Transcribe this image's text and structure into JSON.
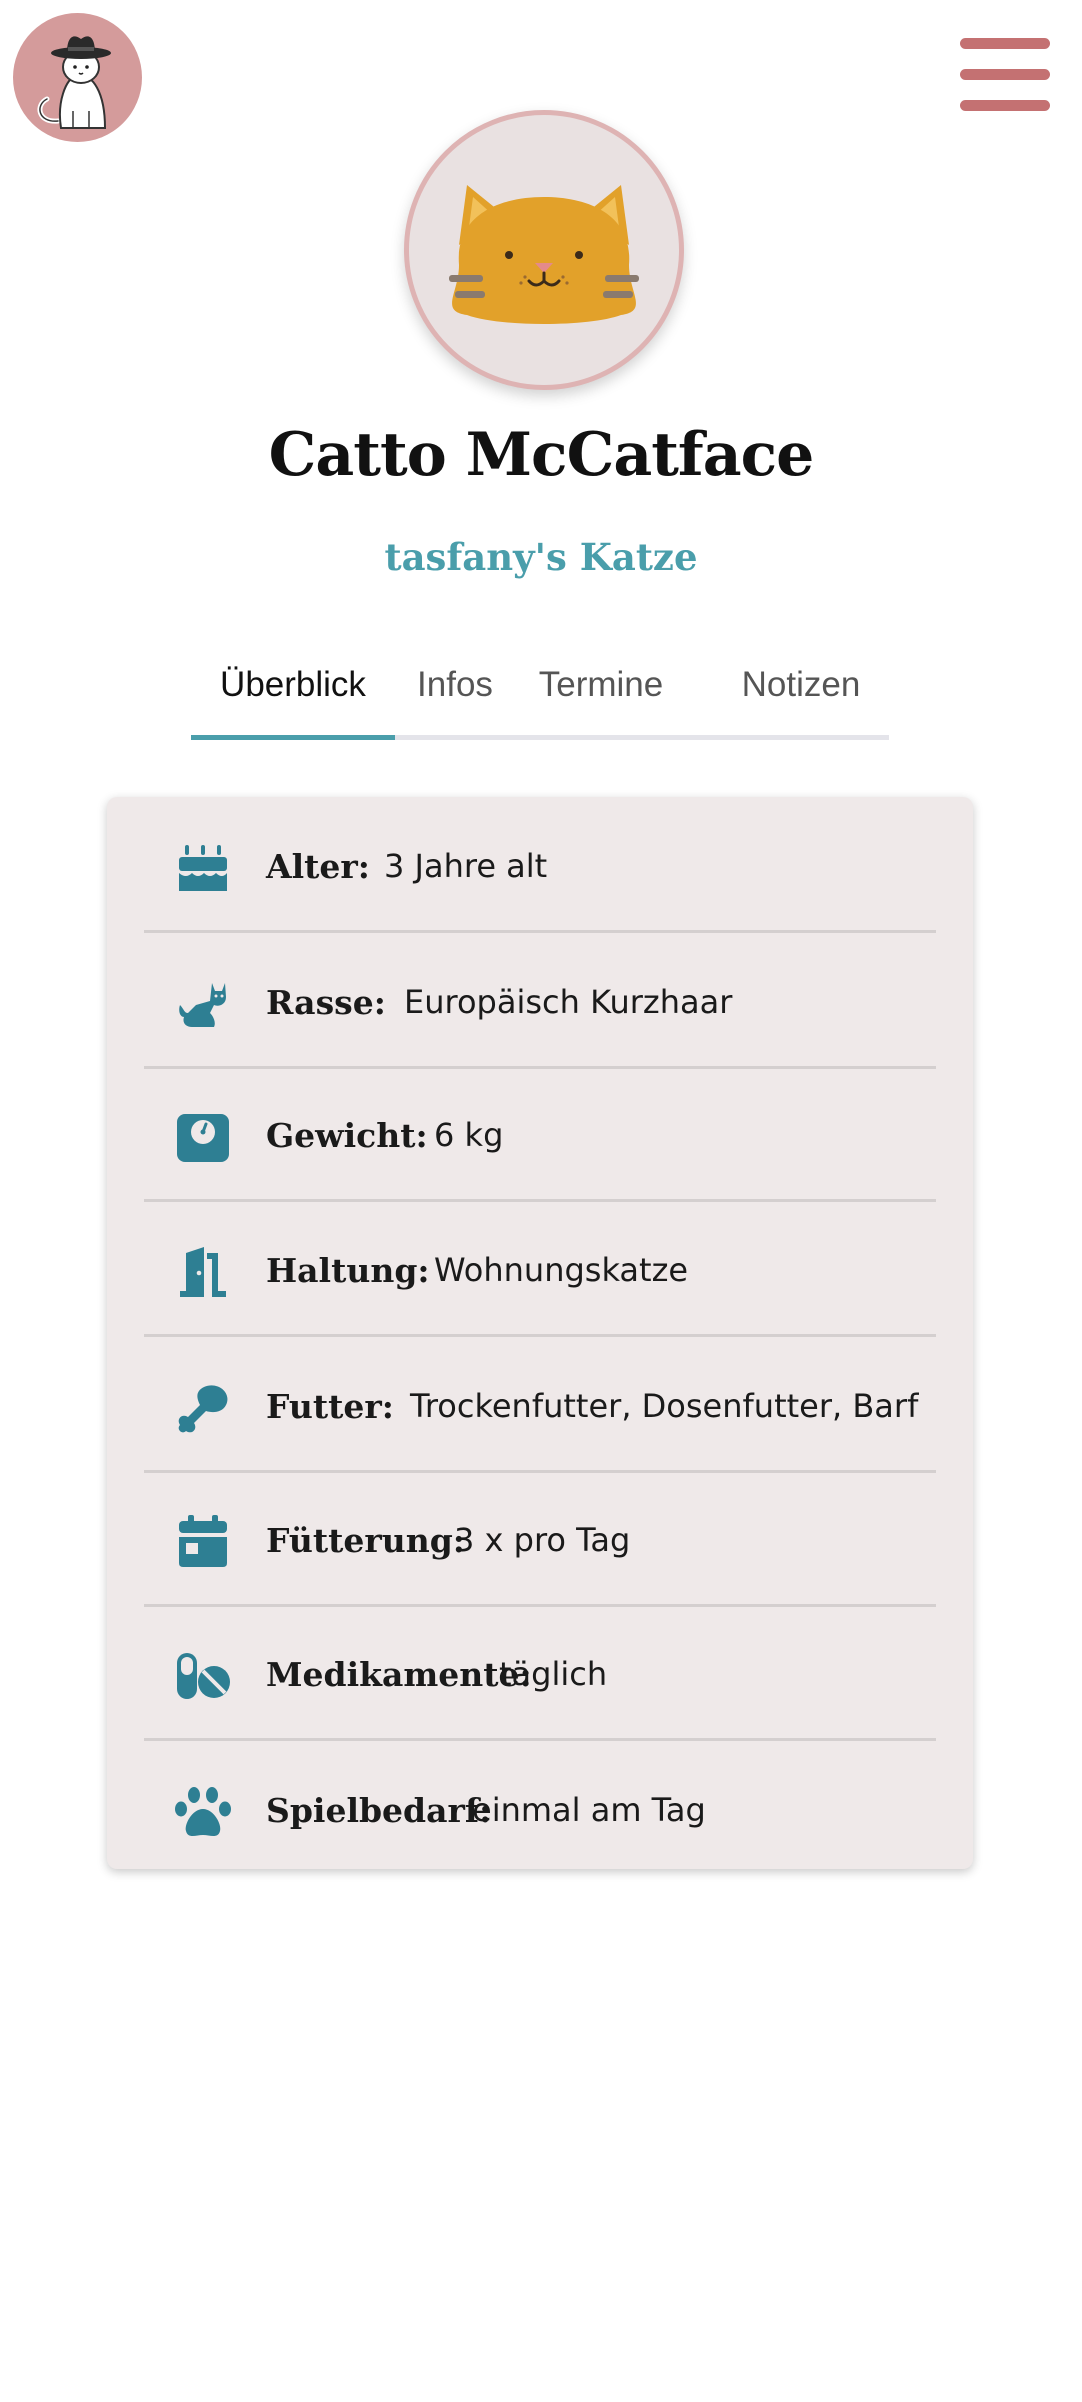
{
  "header": {
    "logo_icon": "cat-with-cowboy-hat-logo",
    "menu_icon": "hamburger-menu-icon"
  },
  "profile": {
    "avatar_icon": "orange-cat-face-avatar",
    "name": "Catto McCatface",
    "owner": "tasfany's Katze"
  },
  "tabs": [
    {
      "label": "Überblick",
      "active": true
    },
    {
      "label": "Infos",
      "active": false
    },
    {
      "label": "Termine",
      "active": false
    },
    {
      "label": "Notizen",
      "active": false
    }
  ],
  "overview": [
    {
      "icon": "birthday-cake-icon",
      "label": "Alter:",
      "value": "3 Jahre alt"
    },
    {
      "icon": "cat-icon",
      "label": "Rasse:",
      "value": "Europäisch Kurzhaar"
    },
    {
      "icon": "weight-scale-icon",
      "label": "Gewicht:",
      "value": "6 kg"
    },
    {
      "icon": "door-open-icon",
      "label": "Haltung:",
      "value": "Wohnungskatze"
    },
    {
      "icon": "drumstick-icon",
      "label": "Futter:",
      "value": "Trockenfutter, Dosenfutter, Barf"
    },
    {
      "icon": "calendar-icon",
      "label": "Fütterung:",
      "value": "3 x pro Tag"
    },
    {
      "icon": "pills-icon",
      "label": "Medikamente:",
      "value": "täglich"
    },
    {
      "icon": "paw-icon",
      "label": "Spielbedarf:",
      "value": "einmal am Tag"
    }
  ],
  "colors": {
    "accent": "#4a9eab",
    "icon": "#2e7f93",
    "menu": "#c47172",
    "logo_bg": "#d49b9b",
    "card_bg": "#efe9e9"
  }
}
